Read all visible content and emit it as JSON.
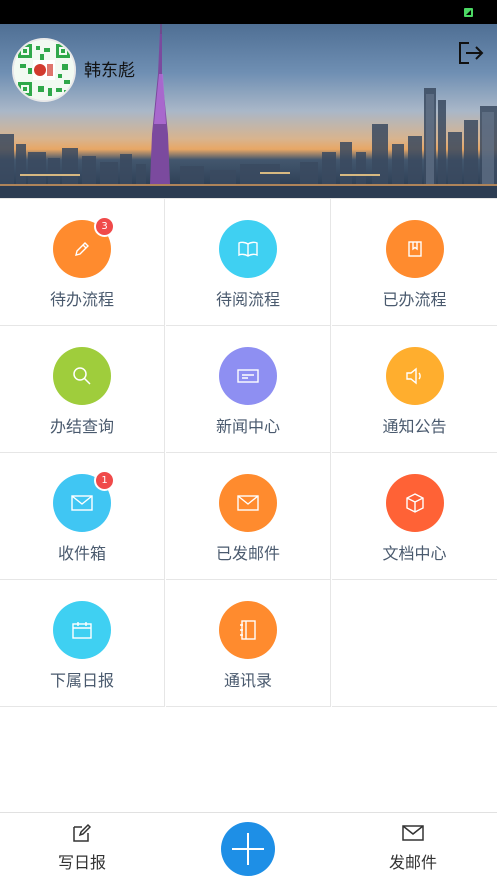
{
  "header": {
    "user_name": "韩东彪",
    "logout_icon": "logout-icon",
    "avatar_icon": "qr-avatar"
  },
  "menu": [
    {
      "label": "待办流程",
      "icon": "pencil-icon",
      "color": "#ff8b2e",
      "badge": "3"
    },
    {
      "label": "待阅流程",
      "icon": "book-icon",
      "color": "#3fd0f2",
      "badge": ""
    },
    {
      "label": "已办流程",
      "icon": "bookmark-icon",
      "color": "#ff8b2e",
      "badge": ""
    },
    {
      "label": "办结查询",
      "icon": "search-icon",
      "color": "#9fcd3c",
      "badge": ""
    },
    {
      "label": "新闻中心",
      "icon": "card-icon",
      "color": "#8e8ff2",
      "badge": ""
    },
    {
      "label": "通知公告",
      "icon": "speaker-icon",
      "color": "#ffae2e",
      "badge": ""
    },
    {
      "label": "收件箱",
      "icon": "mail-icon",
      "color": "#40c6f3",
      "badge": "1"
    },
    {
      "label": "已发邮件",
      "icon": "mail-sent-icon",
      "color": "#ff8b2e",
      "badge": ""
    },
    {
      "label": "文档中心",
      "icon": "box-icon",
      "color": "#ff6236",
      "badge": ""
    },
    {
      "label": "下属日报",
      "icon": "calendar-icon",
      "color": "#3fd0f2",
      "badge": ""
    },
    {
      "label": "通讯录",
      "icon": "contacts-icon",
      "color": "#ff8b2e",
      "badge": ""
    }
  ],
  "bottom_bar": {
    "left_label": "写日报",
    "left_icon": "edit-icon",
    "center_icon": "plus-icon",
    "right_label": "发邮件",
    "right_icon": "mail-icon"
  },
  "colors": {
    "fab": "#1e8fe6",
    "label_text": "#4a5a6e",
    "badge": "#f04a4a"
  }
}
